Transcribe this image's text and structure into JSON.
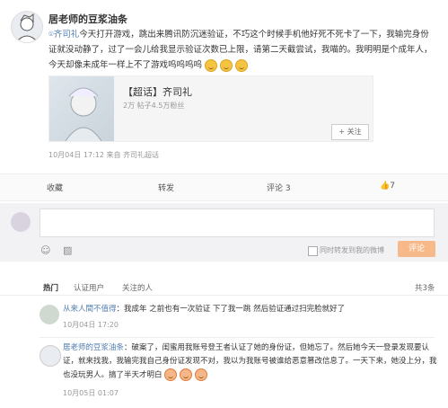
{
  "post": {
    "author": "居老师的豆浆油条",
    "topic": "齐司礼",
    "text": "今天打开游戏，跳出来腾讯防沉迷验证，不巧这个时候手机他好死不死卡了一下，我输完身份证就没动静了，过了一会儿给我显示验证次数已上限，请第二天截尝试，我喵的。我明明是个成年人，今天却像未成年一样上不了游戏呜呜呜呜",
    "card_title": "【超话】齐司礼",
    "card_stats": "2万  帖子4.5万粉丝",
    "follow_label": "+ 关注",
    "meta": "10月04日 17:12  来自 齐司礼超话"
  },
  "actions": {
    "collect": "收藏",
    "repost": "转发",
    "comment": "评论 3",
    "like": "7"
  },
  "composer": {
    "checkbox_label": "同时转发到我的微博",
    "submit": "评论"
  },
  "tabs": {
    "hot": "热门",
    "verified": "认证用户",
    "followed": "关注的人",
    "count": "共3条"
  },
  "comments": [
    {
      "author": "从来人間不值得",
      "text": "我成年 之前也有一次验证 下了我一跳 然后验证通过扫完脸就好了",
      "meta": "10月04日 17:20"
    },
    {
      "author": "居老师的豆浆油条",
      "text": "破案了，闺蜜用我账号登王者认证了她的身份证，但她忘了。然后她今天一登录发现要认证，就来找我，我输完我自己身份证发现不对，我以为我账号被谁给恶意篡改信息了。一天下来，她没上分，我也没玩男人。搞了半天才明白",
      "meta": "10月05日 01:07"
    }
  ],
  "colors": {
    "accent": "#eb7350",
    "link": "#507daf",
    "submit": "#f7b98a"
  }
}
